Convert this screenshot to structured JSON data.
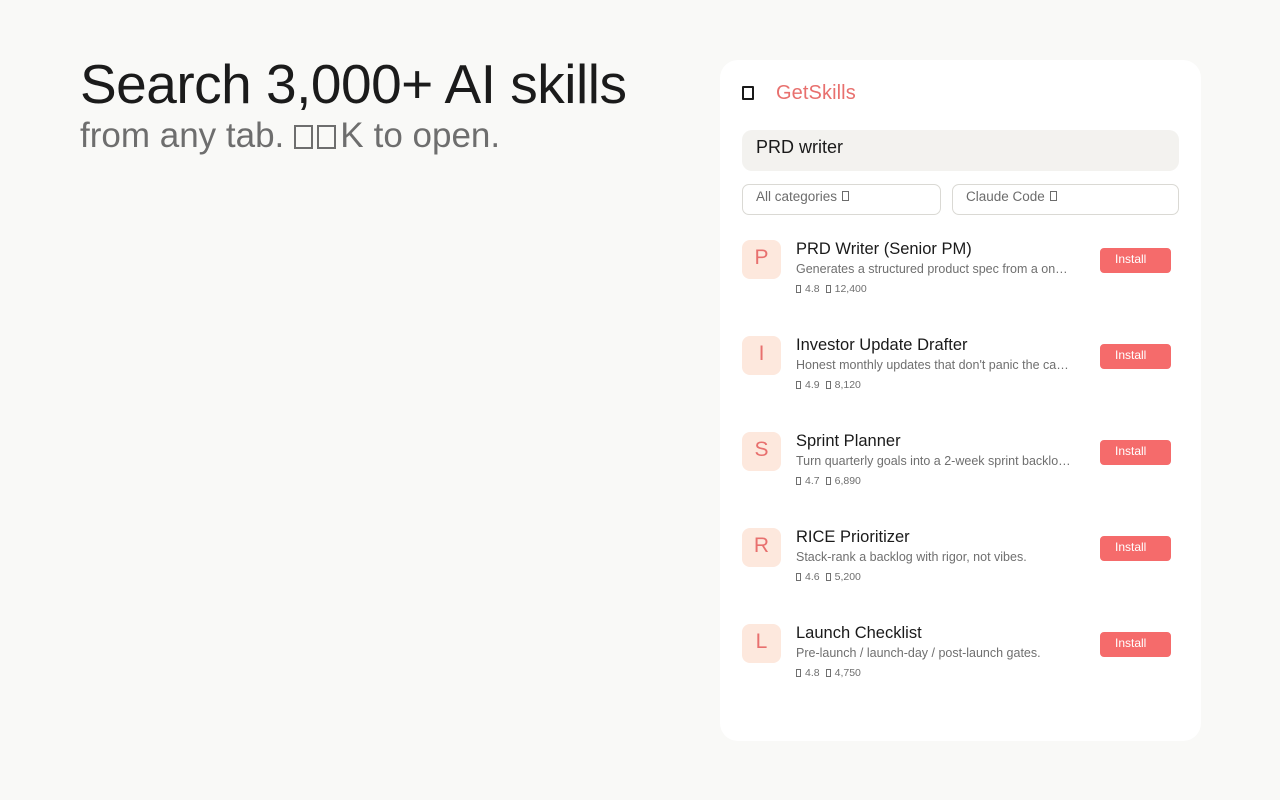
{
  "hero": {
    "title": "Search 3,000+ AI skills",
    "subtitle_prefix": "from any tab.",
    "shortcut_key": "K",
    "subtitle_suffix": "to open."
  },
  "panel": {
    "brand_name": "GetSkills",
    "search_value": "PRD writer",
    "filters": {
      "category": "All categories",
      "target": "Claude Code"
    },
    "results": [
      {
        "initial": "P",
        "name": "PRD Writer (Senior PM)",
        "description": "Generates a structured product spec from a one-l…",
        "rating": "4.8",
        "installs": "12,400",
        "action": "Install"
      },
      {
        "initial": "I",
        "name": "Investor Update Drafter",
        "description": "Honest monthly updates that don't panic the cap …",
        "rating": "4.9",
        "installs": "8,120",
        "action": "Install"
      },
      {
        "initial": "S",
        "name": "Sprint Planner",
        "description": "Turn quarterly goals into a 2-week sprint backlo…",
        "rating": "4.7",
        "installs": "6,890",
        "action": "Install"
      },
      {
        "initial": "R",
        "name": "RICE Prioritizer",
        "description": "Stack-rank a backlog with rigor, not vibes.",
        "rating": "4.6",
        "installs": "5,200",
        "action": "Install"
      },
      {
        "initial": "L",
        "name": "Launch Checklist",
        "description": "Pre-launch / launch-day / post-launch gates.",
        "rating": "4.8",
        "installs": "4,750",
        "action": "Install"
      }
    ]
  },
  "colors": {
    "accent": "#e8706e",
    "button": "#f56b6b",
    "avatar_bg": "#fde8dd",
    "page_bg": "#f9f9f7"
  }
}
